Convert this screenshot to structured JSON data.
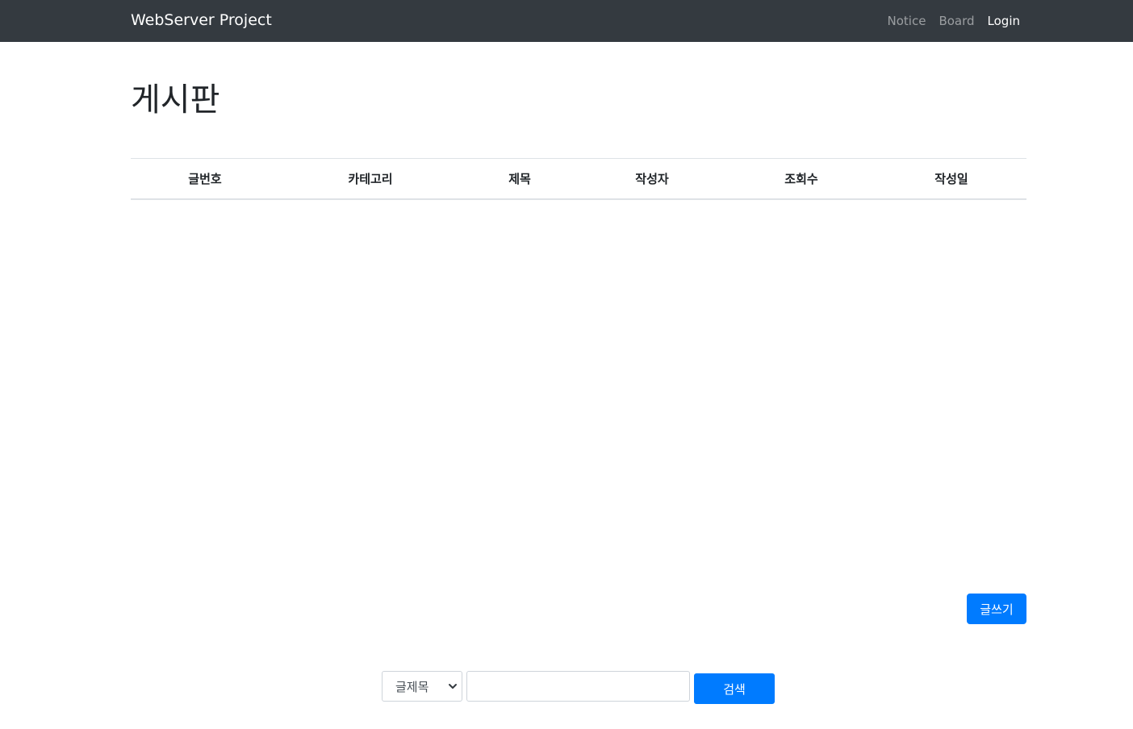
{
  "navbar": {
    "brand": "WebServer Project",
    "links": [
      {
        "label": "Notice"
      },
      {
        "label": "Board"
      },
      {
        "label": "Login"
      }
    ]
  },
  "page": {
    "title": "게시판"
  },
  "table": {
    "headers": [
      "글번호",
      "카테고리",
      "제목",
      "작성자",
      "조회수",
      "작성일"
    ],
    "rows": []
  },
  "actions": {
    "write_label": "글쓰기"
  },
  "search": {
    "selected_option": "글제목",
    "input_value": "",
    "button_label": "검색"
  },
  "colors": {
    "navbar_bg": "#343a40",
    "primary": "#007bff"
  }
}
